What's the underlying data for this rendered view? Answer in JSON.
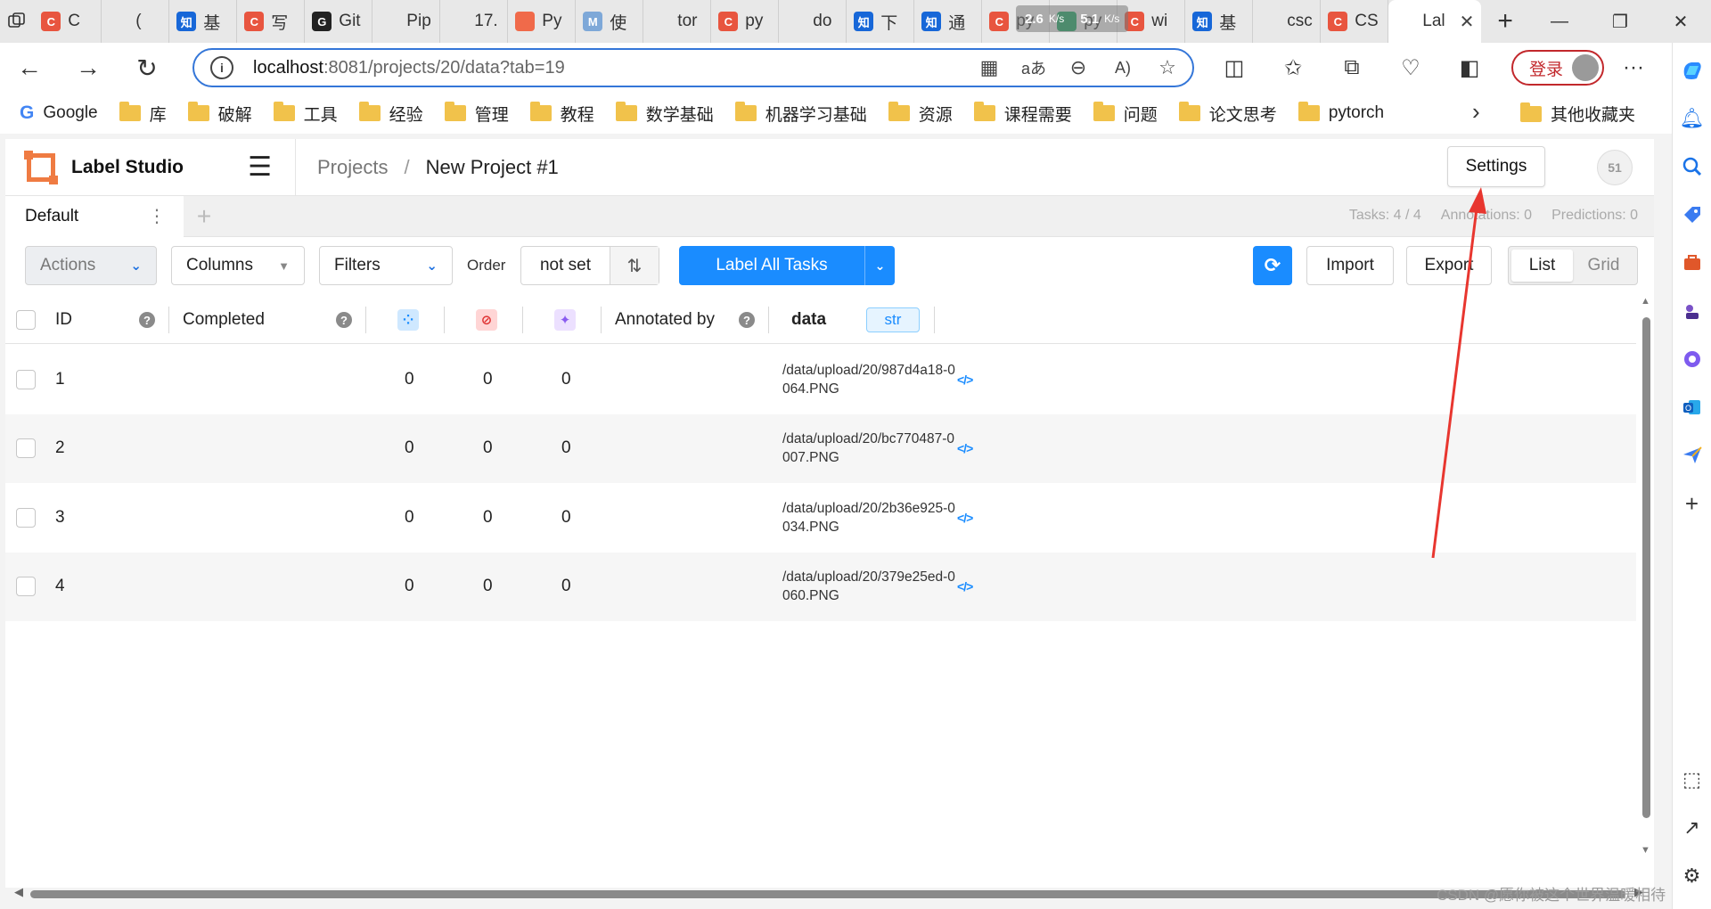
{
  "browser": {
    "tabs": [
      {
        "label": "C",
        "icon_color": "#e8553f",
        "icon_text": "C"
      },
      {
        "label": "(",
        "icon_color": "#e8e8e8",
        "icon_text": ""
      },
      {
        "label": "基",
        "icon_color": "#1767d8",
        "icon_text": "知"
      },
      {
        "label": "写",
        "icon_color": "#e8553f",
        "icon_text": "C"
      },
      {
        "label": "Git",
        "icon_color": "#222222",
        "icon_text": "G"
      },
      {
        "label": "Pip",
        "icon_color": "#e8e8e8",
        "icon_text": ""
      },
      {
        "label": "17.",
        "icon_color": "#e8e8e8",
        "icon_text": ""
      },
      {
        "label": "Py",
        "icon_color": "#f06a4a",
        "icon_text": ""
      },
      {
        "label": "使",
        "icon_color": "#7ea8d8",
        "icon_text": "M"
      },
      {
        "label": "tor",
        "icon_color": "#e8e8e8",
        "icon_text": ""
      },
      {
        "label": "py",
        "icon_color": "#e8553f",
        "icon_text": "C"
      },
      {
        "label": "do",
        "icon_color": "#e8e8e8",
        "icon_text": ""
      },
      {
        "label": "下",
        "icon_color": "#1767d8",
        "icon_text": "知"
      },
      {
        "label": "通",
        "icon_color": "#1767d8",
        "icon_text": "知"
      },
      {
        "label": "py",
        "icon_color": "#e8553f",
        "icon_text": "C"
      },
      {
        "label": "py",
        "icon_color": "#1aa260",
        "icon_text": ""
      },
      {
        "label": "wi",
        "icon_color": "#e8553f",
        "icon_text": "C"
      },
      {
        "label": "基",
        "icon_color": "#1767d8",
        "icon_text": "知"
      },
      {
        "label": "csc",
        "icon_color": "#e8e8e8",
        "icon_text": ""
      },
      {
        "label": "CS",
        "icon_color": "#e8553f",
        "icon_text": "C"
      }
    ],
    "active_tab": {
      "label": "Lal"
    },
    "net_speed": {
      "down": "2.6",
      "up": "5.1",
      "unit": "K/s"
    },
    "url_host": "localhost",
    "url_path": ":8081/projects/20/data?tab=19",
    "login_label": "登录",
    "bookmarks": [
      {
        "label": "Google",
        "type": "google"
      },
      {
        "label": "库",
        "type": "folder"
      },
      {
        "label": "破解",
        "type": "folder"
      },
      {
        "label": "工具",
        "type": "folder"
      },
      {
        "label": "经验",
        "type": "folder"
      },
      {
        "label": "管理",
        "type": "folder"
      },
      {
        "label": "教程",
        "type": "folder"
      },
      {
        "label": "数学基础",
        "type": "folder"
      },
      {
        "label": "机器学习基础",
        "type": "folder"
      },
      {
        "label": "资源",
        "type": "folder"
      },
      {
        "label": "课程需要",
        "type": "folder"
      },
      {
        "label": "问题",
        "type": "folder"
      },
      {
        "label": "论文思考",
        "type": "folder"
      },
      {
        "label": "pytorch",
        "type": "folder"
      }
    ],
    "other_bookmarks": "其他收藏夹"
  },
  "app": {
    "logo_text": "Label Studio",
    "breadcrumb": {
      "projects": "Projects",
      "separator": "/",
      "current": "New Project #1"
    },
    "settings_label": "Settings",
    "user_badge": "51",
    "view_tab": "Default",
    "stats": {
      "tasks": "Tasks: 4 / 4",
      "annotations": "Annotations: 0",
      "predictions": "Predictions: 0"
    },
    "toolbar": {
      "actions": "Actions",
      "columns": "Columns",
      "filters": "Filters",
      "order_label": "Order",
      "order_value": "not set",
      "label_all": "Label All Tasks",
      "import": "Import",
      "export": "Export",
      "list": "List",
      "grid": "Grid"
    },
    "columns": {
      "id": "ID",
      "completed": "Completed",
      "annotated_by": "Annotated by",
      "data": "data",
      "data_type": "str"
    },
    "rows": [
      {
        "id": "1",
        "total": "0",
        "cancelled": "0",
        "predictions": "0",
        "data": "/data/upload/20/987d4a18-0064.PNG"
      },
      {
        "id": "2",
        "total": "0",
        "cancelled": "0",
        "predictions": "0",
        "data": "/data/upload/20/bc770487-0007.PNG"
      },
      {
        "id": "3",
        "total": "0",
        "cancelled": "0",
        "predictions": "0",
        "data": "/data/upload/20/2b36e925-0034.PNG"
      },
      {
        "id": "4",
        "total": "0",
        "cancelled": "0",
        "predictions": "0",
        "data": "/data/upload/20/379e25ed-0060.PNG"
      }
    ]
  },
  "watermark": "CSDN @愿你被这个世界温暖相待",
  "colors": {
    "accent": "#1a8cff",
    "logo": "#ef7b42",
    "annotation_arrow": "#e8362f"
  }
}
